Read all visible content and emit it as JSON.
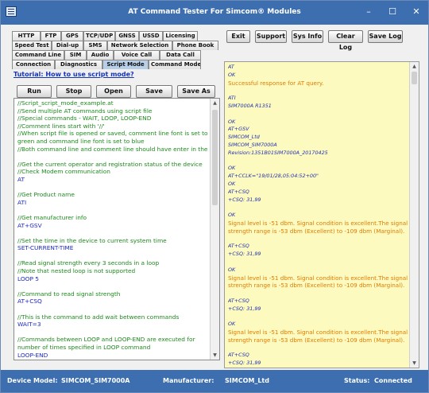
{
  "window": {
    "title": "AT Command Tester For Simcom® Modules",
    "controls": {
      "minimize": "–",
      "maximize": "☐",
      "close": "✕"
    }
  },
  "tabs": {
    "rows": [
      [
        {
          "label": "HTTP",
          "w": 36
        },
        {
          "label": "FTP",
          "w": 26
        },
        {
          "label": "GPS",
          "w": 28
        },
        {
          "label": "TCP/UDP",
          "w": 40
        },
        {
          "label": "GNSS",
          "w": 30
        },
        {
          "label": "USSD",
          "w": 30
        },
        {
          "label": "Licensing",
          "w": 44
        }
      ],
      [
        {
          "label": "Speed Test",
          "w": 50
        },
        {
          "label": "Dial-up",
          "w": 40
        },
        {
          "label": "SMS",
          "w": 30
        },
        {
          "label": "Network Selection",
          "w": 82
        },
        {
          "label": "Phone Book",
          "w": 58
        }
      ],
      [
        {
          "label": "Command Line",
          "w": 66
        },
        {
          "label": "SIM",
          "w": 28
        },
        {
          "label": "Audio",
          "w": 34
        },
        {
          "label": "Voice Call",
          "w": 58
        },
        {
          "label": "Data Call",
          "w": 52
        }
      ],
      [
        {
          "label": "Connection",
          "w": 54
        },
        {
          "label": "Diagnostics",
          "w": 60
        },
        {
          "label": "Script Mode",
          "w": 58,
          "active": true
        },
        {
          "label": "Command Mode",
          "w": 66
        }
      ]
    ]
  },
  "script_mode": {
    "tutorial_link": "Tutorial: How to use script mode?",
    "buttons": {
      "run": "Run",
      "stop": "Stop",
      "open": "Open",
      "save": "Save",
      "save_as": "Save As"
    },
    "lines": [
      {
        "t": "//Script_script_mode_example.at",
        "k": "comment"
      },
      {
        "t": "//Send multiple AT commands using script file",
        "k": "comment"
      },
      {
        "t": "//Special commands - WAIT, LOOP, LOOP-END",
        "k": "comment"
      },
      {
        "t": "//Comment lines start with '//'",
        "k": "comment"
      },
      {
        "t": "//When script file is opened or saved, comment line font is set to",
        "k": "comment"
      },
      {
        "t": "green and command line font is set to blue",
        "k": "comment"
      },
      {
        "t": "//Both command line and comment line should have enter in the end",
        "k": "comment"
      },
      {
        "t": "",
        "k": "comment"
      },
      {
        "t": "//Get the current operator and registration status of the device",
        "k": "comment"
      },
      {
        "t": "//Check Modem communication",
        "k": "comment"
      },
      {
        "t": "AT",
        "k": "command"
      },
      {
        "t": "",
        "k": "comment"
      },
      {
        "t": "//Get Product name",
        "k": "comment"
      },
      {
        "t": "ATI",
        "k": "command"
      },
      {
        "t": "",
        "k": "comment"
      },
      {
        "t": "//Get manufacturer info",
        "k": "comment"
      },
      {
        "t": "AT+GSV",
        "k": "command"
      },
      {
        "t": "",
        "k": "comment"
      },
      {
        "t": "//Set the time in the device to current system time",
        "k": "comment"
      },
      {
        "t": "SET-CURRENT-TIME",
        "k": "command"
      },
      {
        "t": "",
        "k": "comment"
      },
      {
        "t": "//Read signal strength every 3 seconds in a loop",
        "k": "comment"
      },
      {
        "t": "//Note that nested loop is not supported",
        "k": "comment"
      },
      {
        "t": "LOOP 5",
        "k": "command"
      },
      {
        "t": "",
        "k": "comment"
      },
      {
        "t": "//Command to read signal strength",
        "k": "comment"
      },
      {
        "t": "AT+CSQ",
        "k": "command"
      },
      {
        "t": "",
        "k": "comment"
      },
      {
        "t": "//This is the command to add wait between commands",
        "k": "comment"
      },
      {
        "t": "WAIT=3",
        "k": "command"
      },
      {
        "t": "",
        "k": "comment"
      },
      {
        "t": "//Commands between LOOP and LOOP-END are executed for",
        "k": "comment"
      },
      {
        "t": "number of times specified in LOOP command",
        "k": "comment"
      },
      {
        "t": "LOOP-END",
        "k": "command"
      }
    ]
  },
  "toolbar": {
    "buttons": [
      {
        "label": "Exit",
        "w": 30
      },
      {
        "label": "Support",
        "w": 40
      },
      {
        "label": "Sys Info",
        "w": 40
      },
      {
        "label": "Clear Log",
        "w": 44
      },
      {
        "label": "Save Log",
        "w": 44
      }
    ]
  },
  "log": {
    "lines": [
      {
        "t": "AT",
        "k": "resp"
      },
      {
        "t": "OK",
        "k": "resp"
      },
      {
        "t": "Successful response for AT query.",
        "k": "info"
      },
      {
        "t": "",
        "k": "blank"
      },
      {
        "t": "ATI",
        "k": "resp"
      },
      {
        "t": "SIM7000A R1351",
        "k": "resp"
      },
      {
        "t": "",
        "k": "blank"
      },
      {
        "t": "OK",
        "k": "resp"
      },
      {
        "t": "AT+GSV",
        "k": "resp"
      },
      {
        "t": "SIMCOM_Ltd",
        "k": "resp"
      },
      {
        "t": "SIMCOM_SIM7000A",
        "k": "resp"
      },
      {
        "t": "Revision:1351B01SIM7000A_20170425",
        "k": "resp"
      },
      {
        "t": "",
        "k": "blank"
      },
      {
        "t": "OK",
        "k": "resp"
      },
      {
        "t": "AT+CCLK=\"19/01/28,05:04:52+00\"",
        "k": "resp"
      },
      {
        "t": "OK",
        "k": "resp"
      },
      {
        "t": "AT+CSQ",
        "k": "resp"
      },
      {
        "t": "+CSQ: 31,99",
        "k": "resp"
      },
      {
        "t": "",
        "k": "blank"
      },
      {
        "t": "OK",
        "k": "resp"
      },
      {
        "t": "Signal level is -51 dbm. Signal condition is excellent.The signal",
        "k": "info"
      },
      {
        "t": "strength range is -53 dbm (Excellent) to -109 dbm (Marginal).",
        "k": "info"
      },
      {
        "t": "",
        "k": "blank"
      },
      {
        "t": "AT+CSQ",
        "k": "resp"
      },
      {
        "t": "+CSQ: 31,99",
        "k": "resp"
      },
      {
        "t": "",
        "k": "blank"
      },
      {
        "t": "OK",
        "k": "resp"
      },
      {
        "t": "Signal level is -51 dbm. Signal condition is excellent.The signal",
        "k": "info"
      },
      {
        "t": "strength range is -53 dbm (Excellent) to -109 dbm (Marginal).",
        "k": "info"
      },
      {
        "t": "",
        "k": "blank"
      },
      {
        "t": "AT+CSQ",
        "k": "resp"
      },
      {
        "t": "+CSQ: 31,99",
        "k": "resp"
      },
      {
        "t": "",
        "k": "blank"
      },
      {
        "t": "OK",
        "k": "resp"
      },
      {
        "t": "Signal level is -51 dbm. Signal condition is excellent.The signal",
        "k": "info"
      },
      {
        "t": "strength range is -53 dbm (Excellent) to -109 dbm (Marginal).",
        "k": "info"
      },
      {
        "t": "",
        "k": "blank"
      },
      {
        "t": "AT+CSQ",
        "k": "resp"
      },
      {
        "t": "+CSQ: 31,99",
        "k": "resp"
      },
      {
        "t": "",
        "k": "blank"
      },
      {
        "t": "OK",
        "k": "resp"
      },
      {
        "t": "Signal level is -51 dbm. Signal condition is excellent.The signal",
        "k": "info"
      }
    ]
  },
  "status": {
    "device_model_label": "Device Model:",
    "device_model_value": "SIMCOM_SIM7000A",
    "manufacturer_label": "Manufacturer:",
    "manufacturer_value": "SIMCOM_Ltd",
    "status_label": "Status:",
    "status_value": "Connected"
  },
  "colors": {
    "title_bar": "#3d6fb0",
    "log_background": "#fdfabf",
    "comment_text": "#1c8a1c",
    "command_text": "#1c28c8",
    "log_info_text": "#e07b00",
    "log_response_text": "#2232b0"
  },
  "icons": {
    "app": "app-window-icon",
    "scroll_up": "▲",
    "scroll_down": "▼"
  }
}
